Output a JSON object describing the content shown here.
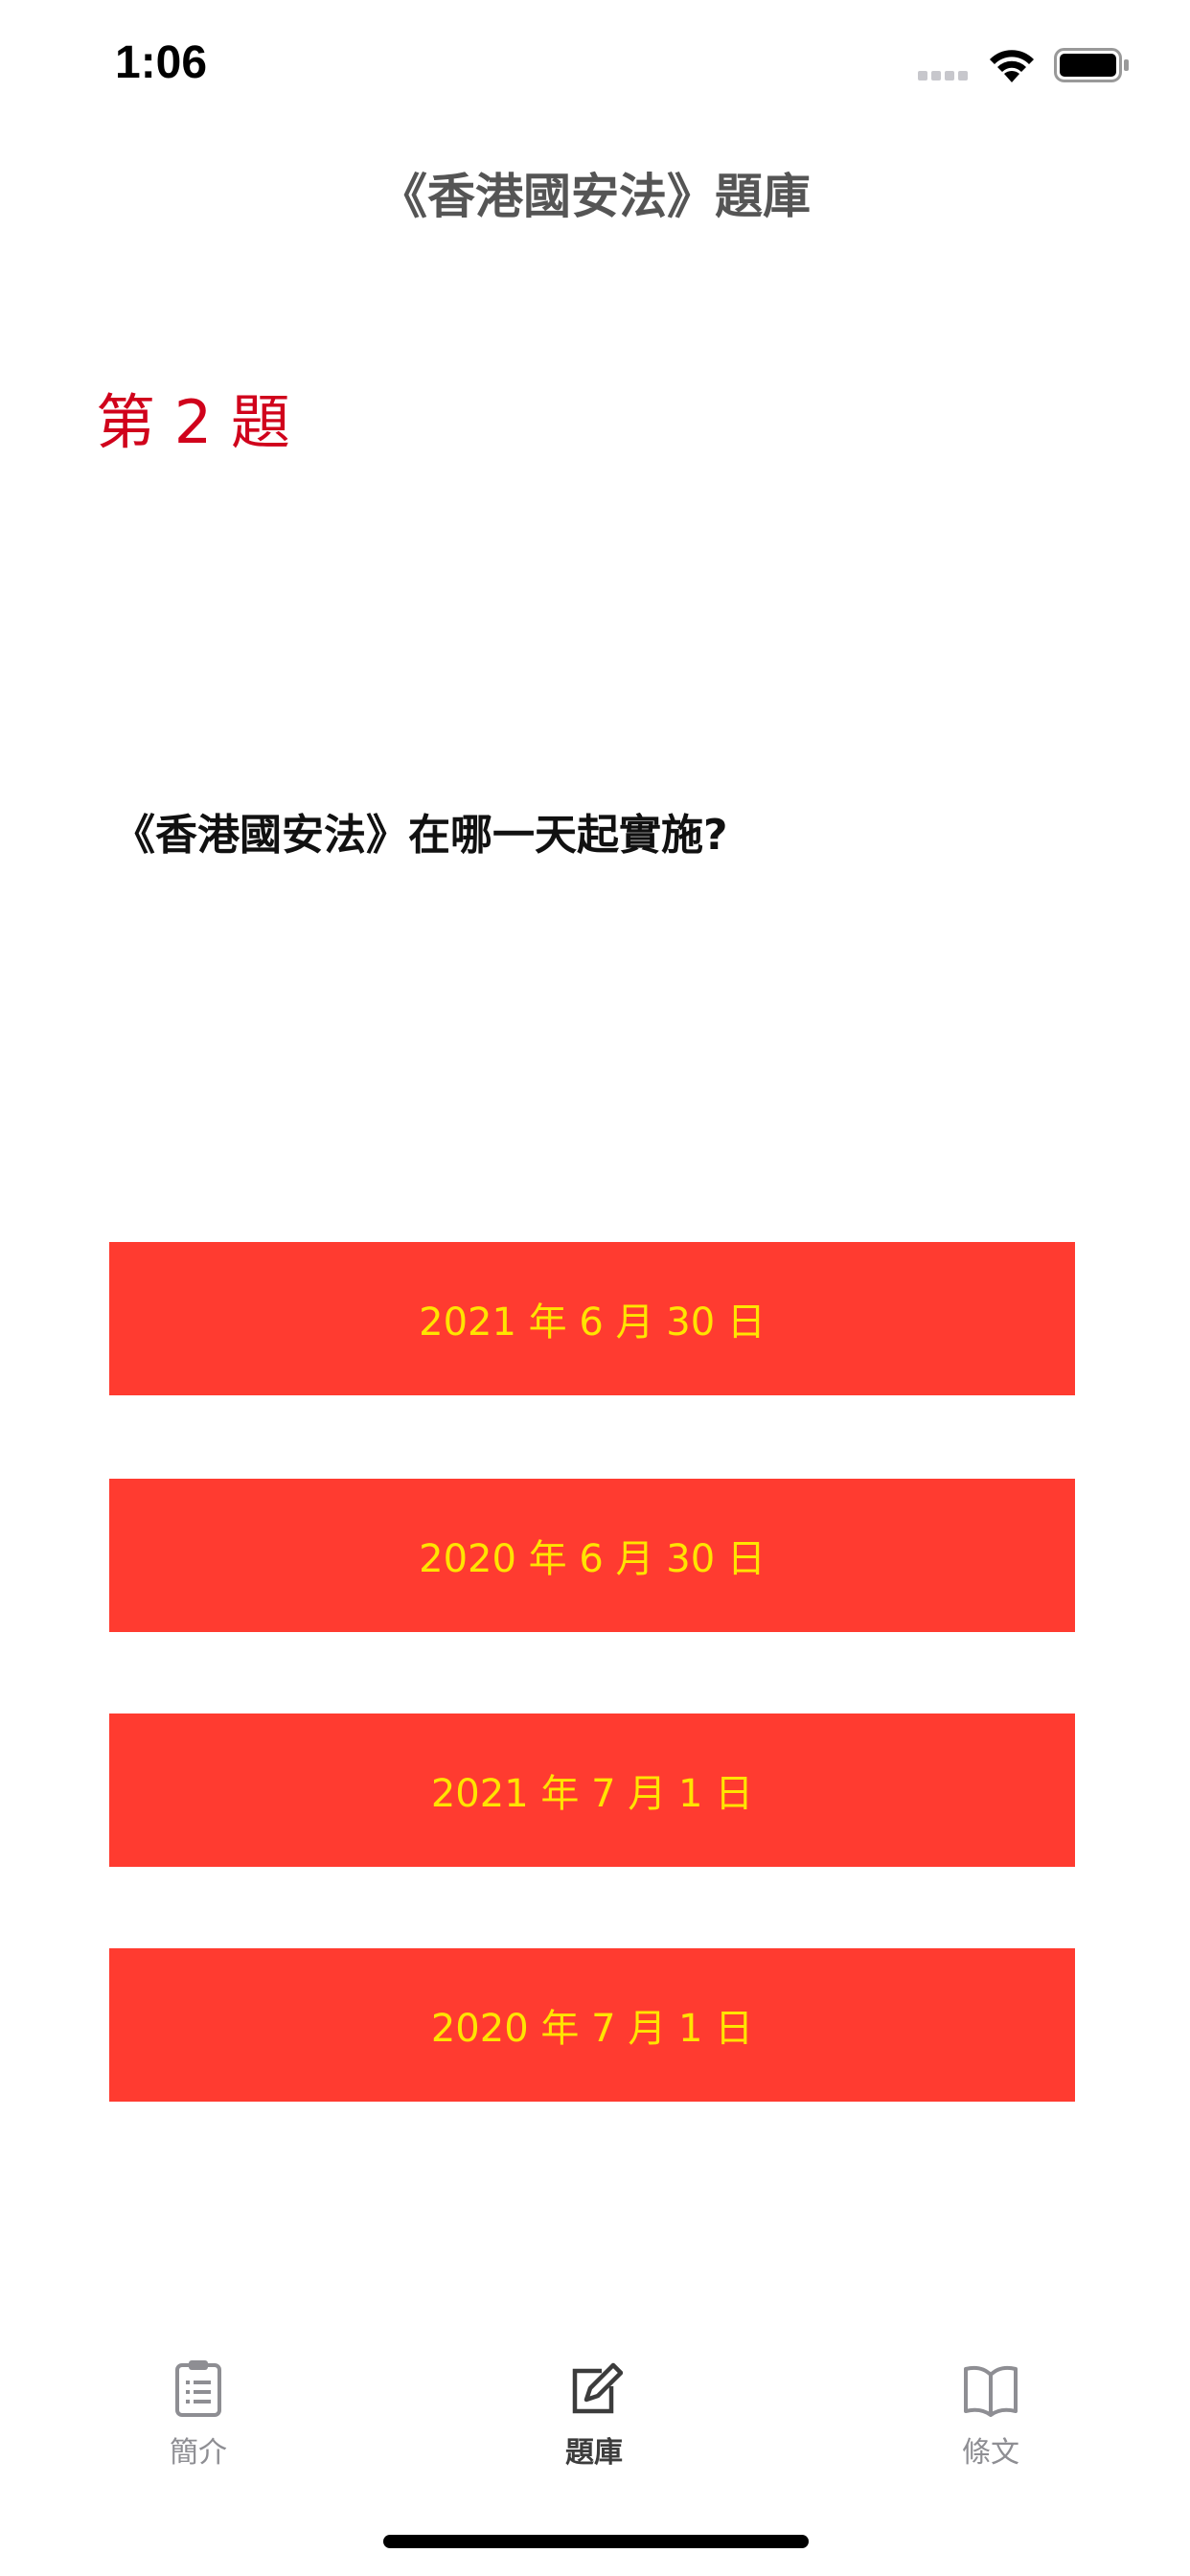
{
  "status_bar": {
    "time": "1:06"
  },
  "nav": {
    "title": "《香港國安法》題庫"
  },
  "question": {
    "number_label": "第 2 題",
    "text": "《香港國安法》在哪一天起實施?"
  },
  "options": [
    {
      "label": "2021 年 6 月 30 日"
    },
    {
      "label": "2020 年 6 月 30 日"
    },
    {
      "label": "2021 年 7 月 1 日"
    },
    {
      "label": "2020 年 7 月 1 日"
    }
  ],
  "colors": {
    "accent_red": "#ff3b30",
    "option_text": "#ffe400",
    "question_number": "#d0021b"
  },
  "tab_bar": {
    "items": [
      {
        "label": "簡介",
        "icon": "clipboard-icon",
        "active": false
      },
      {
        "label": "題庫",
        "icon": "edit-icon",
        "active": true
      },
      {
        "label": "條文",
        "icon": "book-icon",
        "active": false
      }
    ]
  }
}
